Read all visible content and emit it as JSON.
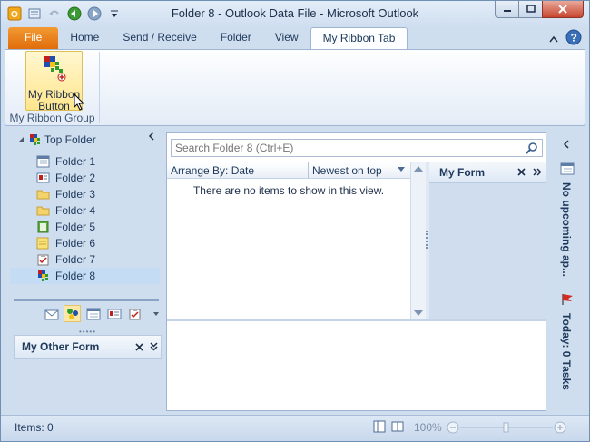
{
  "window": {
    "title": "Folder 8 - Outlook Data File - Microsoft Outlook"
  },
  "ribbon": {
    "tabs": [
      "File",
      "Home",
      "Send / Receive",
      "Folder",
      "View",
      "My Ribbon Tab"
    ],
    "active_tab": "My Ribbon Tab",
    "button_label_line1": "My Ribbon",
    "button_label_line2": "Button",
    "group_label": "My Ribbon Group"
  },
  "nav": {
    "top_folder": "Top Folder",
    "folders": [
      "Folder 1",
      "Folder 2",
      "Folder 3",
      "Folder 4",
      "Folder 5",
      "Folder 6",
      "Folder 7",
      "Folder 8"
    ],
    "selected_folder": "Folder 8",
    "other_form_title": "My Other Form"
  },
  "main": {
    "search_placeholder": "Search Folder 8 (Ctrl+E)",
    "arrange_by": "Arrange By: Date",
    "sort_order": "Newest on top",
    "empty_message": "There are no items to show in this view.",
    "form_title": "My Form"
  },
  "todo": {
    "appointments": "No upcoming ap...",
    "tasks": "Today: 0 Tasks"
  },
  "status": {
    "items": "Items: 0",
    "zoom": "100%"
  },
  "colors": {
    "file_tab": "#e8780f",
    "selected_row": "#c5dcf5",
    "ribbon_button_hover": "#ffe58c",
    "close_button": "#c7462f"
  }
}
